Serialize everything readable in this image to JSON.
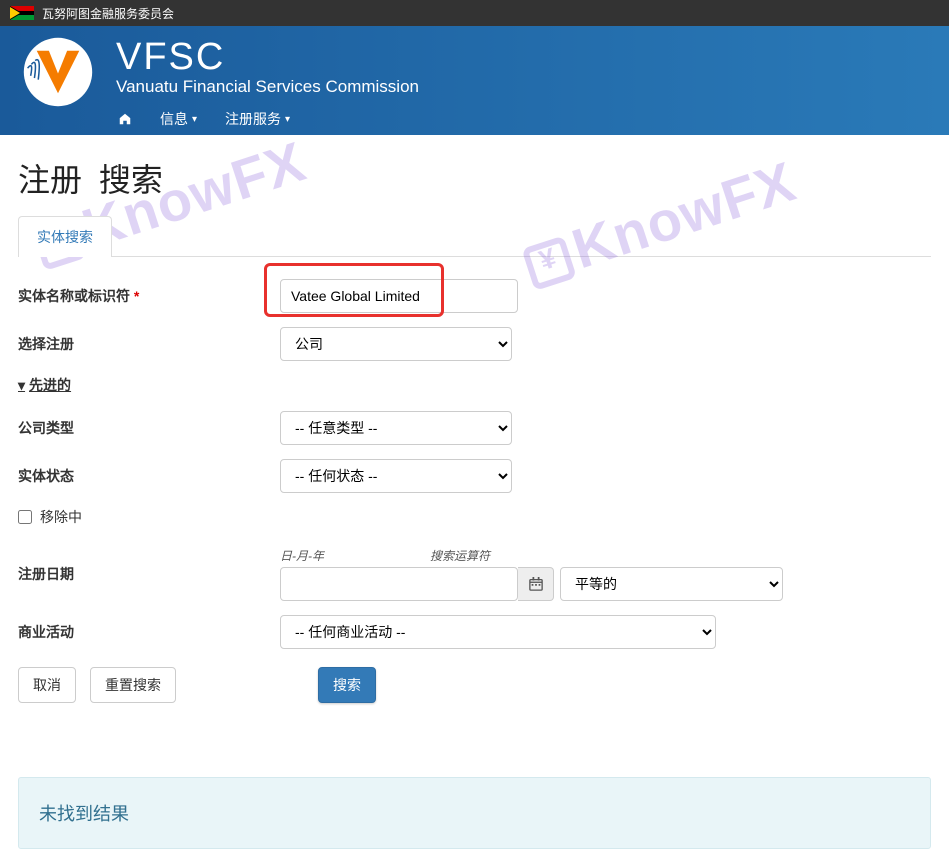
{
  "topbar": {
    "title": "瓦努阿图金融服务委员会"
  },
  "brand": {
    "title": "VFSC",
    "subtitle": "Vanuatu Financial Services Commission"
  },
  "nav": {
    "info": "信息",
    "reg_services": "注册服务"
  },
  "page": {
    "title_a": "注册",
    "title_b": "搜索"
  },
  "tabs": {
    "entity_search": "实体搜索"
  },
  "form": {
    "entity_name_label": "实体名称或标识符",
    "entity_name_value": "Vatee Global Limited",
    "select_reg_label": "选择注册",
    "select_reg_value": "公司",
    "advanced_label": "先进的",
    "company_type_label": "公司类型",
    "company_type_value": "-- 任意类型 --",
    "entity_status_label": "实体状态",
    "entity_status_value": "-- 任何状态 --",
    "removing_label": "移除中",
    "reg_date_label": "注册日期",
    "date_format_hint": "日-月-年",
    "date_operator_hint": "搜索运算符",
    "date_operator_value": "平等的",
    "business_activity_label": "商业活动",
    "business_activity_value": "-- 任何商业活动 --"
  },
  "buttons": {
    "cancel": "取消",
    "reset": "重置搜索",
    "search": "搜索"
  },
  "results": {
    "no_results": "未找到结果"
  },
  "watermark": {
    "text": "KnowFX"
  }
}
